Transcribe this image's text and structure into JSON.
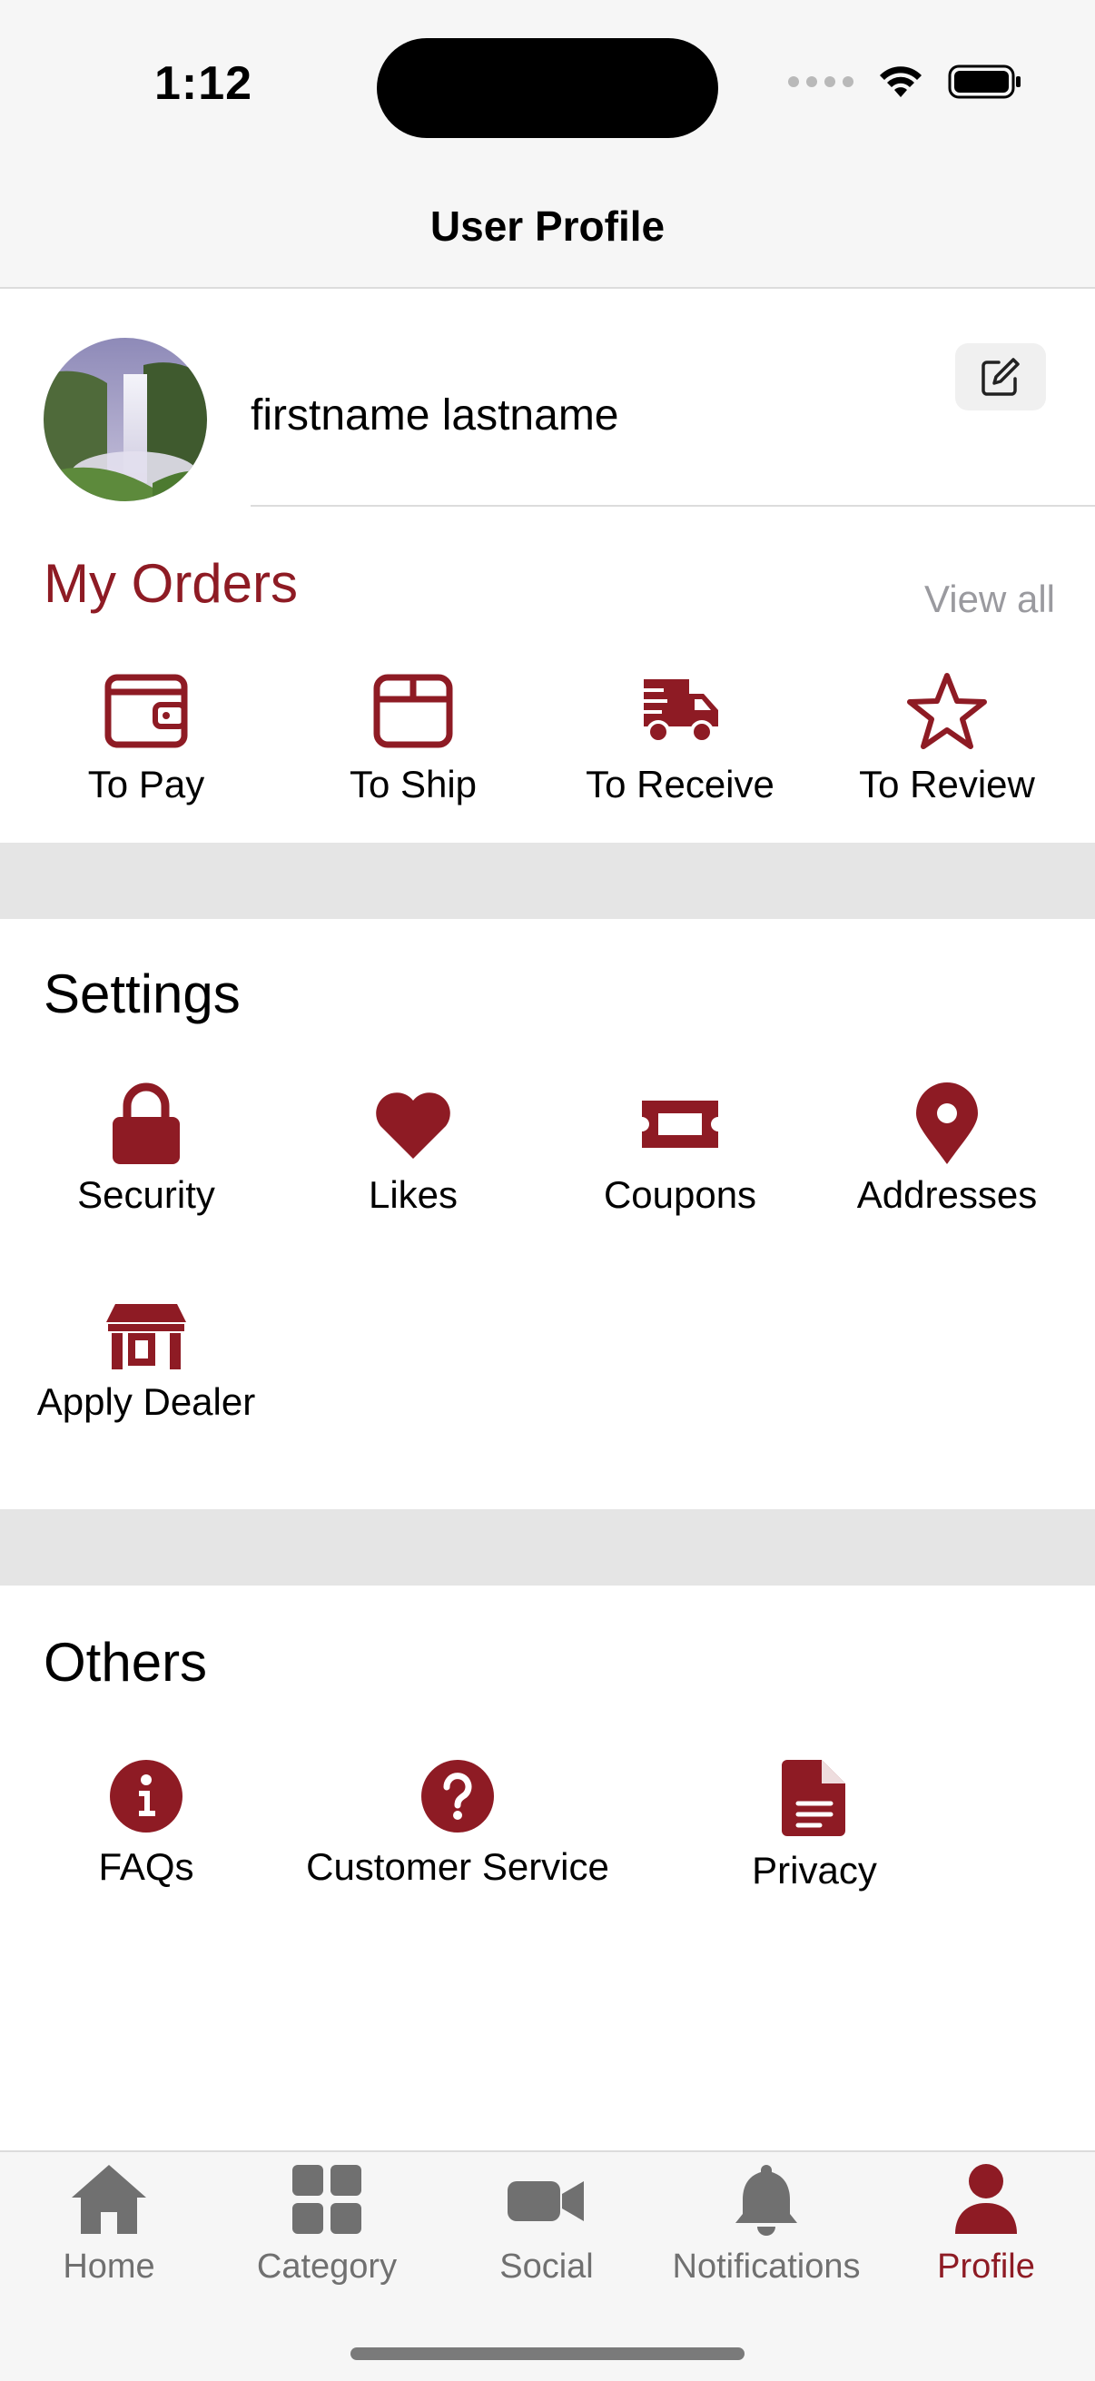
{
  "status_bar": {
    "time": "1:12"
  },
  "nav": {
    "title": "User Profile"
  },
  "profile": {
    "name": "firstname lastname"
  },
  "orders": {
    "title": "My Orders",
    "view_all": "View all",
    "items": [
      {
        "label": "To Pay",
        "icon": "wallet-icon"
      },
      {
        "label": "To Ship",
        "icon": "box-icon"
      },
      {
        "label": "To Receive",
        "icon": "truck-icon"
      },
      {
        "label": "To Review",
        "icon": "star-icon"
      }
    ]
  },
  "settings": {
    "title": "Settings",
    "items": [
      {
        "label": "Security",
        "icon": "lock-icon"
      },
      {
        "label": "Likes",
        "icon": "heart-icon"
      },
      {
        "label": "Coupons",
        "icon": "ticket-icon"
      },
      {
        "label": "Addresses",
        "icon": "location-pin-icon"
      },
      {
        "label": "Apply Dealer",
        "icon": "store-icon"
      }
    ]
  },
  "others": {
    "title": "Others",
    "items": [
      {
        "label": "FAQs",
        "icon": "info-icon"
      },
      {
        "label": "Customer Service",
        "icon": "question-icon"
      },
      {
        "label": "Privacy",
        "icon": "document-icon"
      }
    ]
  },
  "tabbar": {
    "items": [
      {
        "label": "Home",
        "icon": "home-icon"
      },
      {
        "label": "Category",
        "icon": "grid-icon"
      },
      {
        "label": "Social",
        "icon": "video-icon"
      },
      {
        "label": "Notifications",
        "icon": "bell-icon"
      },
      {
        "label": "Profile",
        "icon": "person-icon"
      }
    ],
    "active": "Profile"
  },
  "colors": {
    "accent": "#8e1b24",
    "inactive": "#707070",
    "muted_text": "#9a9a9f",
    "band": "#e5e5e5"
  }
}
